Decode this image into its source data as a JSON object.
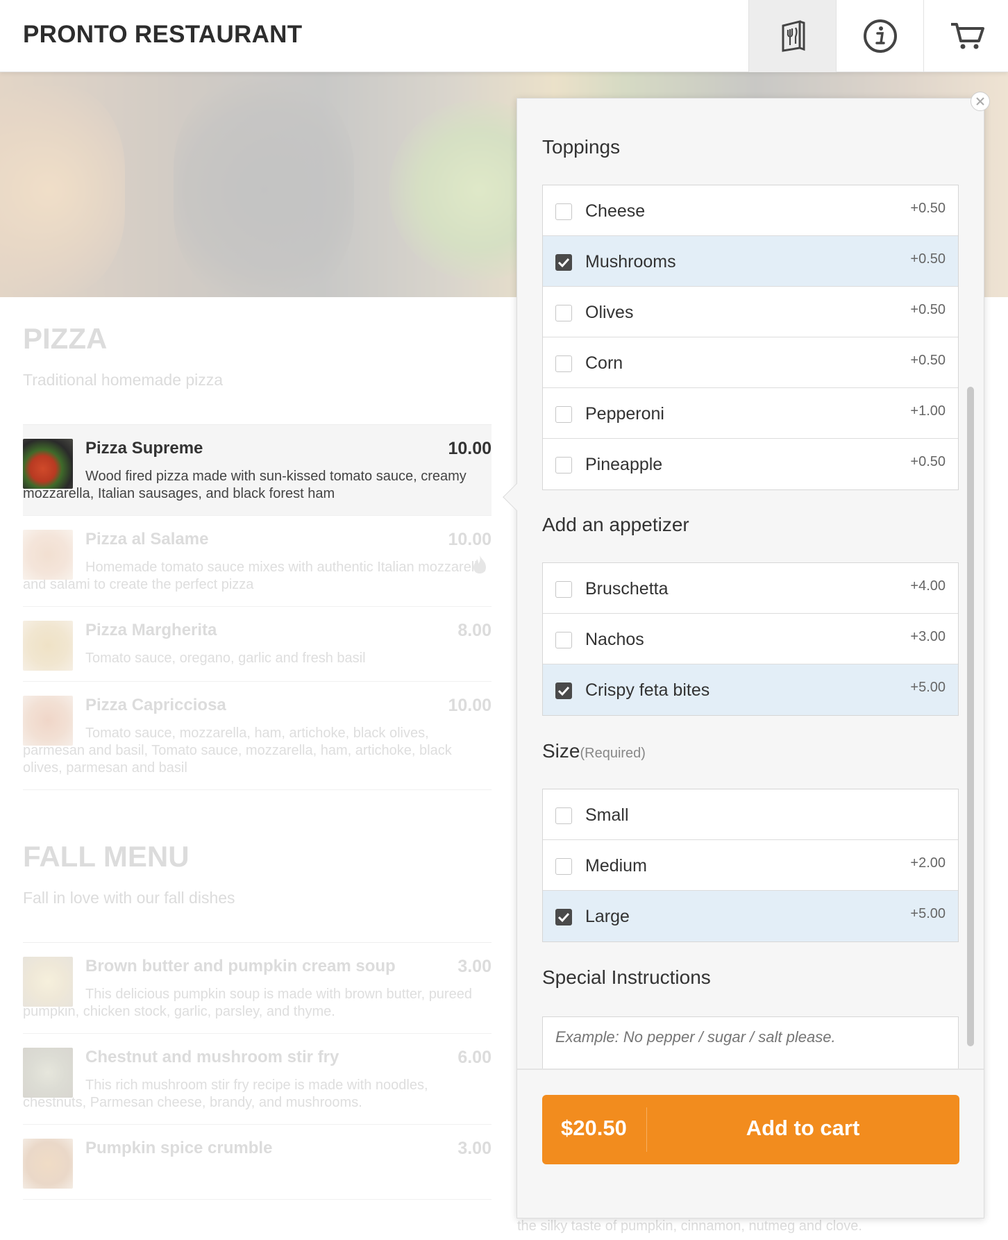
{
  "header": {
    "brand": "PRONTO RESTAURANT",
    "nav": [
      {
        "name": "menu-book-icon",
        "active": true
      },
      {
        "name": "info-icon",
        "active": false
      },
      {
        "name": "cart-icon",
        "active": false
      }
    ]
  },
  "menu": {
    "categories": [
      {
        "title": "PIZZA",
        "subtitle": "Traditional homemade pizza",
        "items": [
          {
            "name": "Pizza Supreme",
            "price": "10.00",
            "desc": "Wood fired pizza made with sun-kissed tomato sauce, creamy mozzarella, Italian sausages, and black forest ham",
            "selected": true
          },
          {
            "name": "Pizza al Salame",
            "price": "10.00",
            "desc": "Homemade tomato sauce mixes with authentic Italian mozzarella and salami to create the perfect pizza",
            "spicy": true
          },
          {
            "name": "Pizza Margherita",
            "price": "8.00",
            "desc": "Tomato sauce, oregano, garlic and fresh basil"
          },
          {
            "name": "Pizza Capricciosa",
            "price": "10.00",
            "desc": "Tomato sauce, mozzarella, ham, artichoke, black olives, parmesan and basil, Tomato sauce, mozzarella, ham, artichoke, black olives, parmesan and basil"
          }
        ]
      },
      {
        "title": "FALL MENU",
        "subtitle": "Fall in love with our fall dishes",
        "items": [
          {
            "name": "Brown butter and pumpkin cream soup",
            "price": "3.00",
            "desc": "This delicious pumpkin soup is made with brown butter, pureed pumpkin, chicken stock, garlic, parsley, and thyme."
          },
          {
            "name": "Chestnut and mushroom stir fry",
            "price": "6.00",
            "desc": "This rich mushroom stir fry recipe is made with noodles, chestnuts, Parmesan cheese, brandy, and mushrooms."
          },
          {
            "name": "Pumpkin spice crumble",
            "price": "3.00",
            "desc": ""
          }
        ]
      }
    ],
    "tail_text": "the silky taste of pumpkin, cinnamon, nutmeg and clove."
  },
  "modal": {
    "sections": {
      "toppings": {
        "title": "Toppings",
        "options": [
          {
            "label": "Cheese",
            "price": "+0.50",
            "checked": false
          },
          {
            "label": "Mushrooms",
            "price": "+0.50",
            "checked": true
          },
          {
            "label": "Olives",
            "price": "+0.50",
            "checked": false
          },
          {
            "label": "Corn",
            "price": "+0.50",
            "checked": false
          },
          {
            "label": "Pepperoni",
            "price": "+1.00",
            "checked": false
          },
          {
            "label": "Pineapple",
            "price": "+0.50",
            "checked": false
          }
        ]
      },
      "appetizer": {
        "title": "Add an appetizer",
        "options": [
          {
            "label": "Bruschetta",
            "price": "+4.00",
            "checked": false
          },
          {
            "label": "Nachos",
            "price": "+3.00",
            "checked": false
          },
          {
            "label": "Crispy feta bites",
            "price": "+5.00",
            "checked": true
          }
        ]
      },
      "size": {
        "title": "Size",
        "required": "(Required)",
        "options": [
          {
            "label": "Small",
            "price": "",
            "checked": false
          },
          {
            "label": "Medium",
            "price": "+2.00",
            "checked": false
          },
          {
            "label": "Large",
            "price": "+5.00",
            "checked": true
          }
        ]
      },
      "instructions": {
        "title": "Special Instructions",
        "placeholder": "Example: No pepper / sugar / salt please."
      }
    },
    "footer": {
      "total": "$20.50",
      "button_label": "Add to cart"
    }
  },
  "colors": {
    "accent": "#f28c1e",
    "checked_row": "#e3eef7"
  }
}
